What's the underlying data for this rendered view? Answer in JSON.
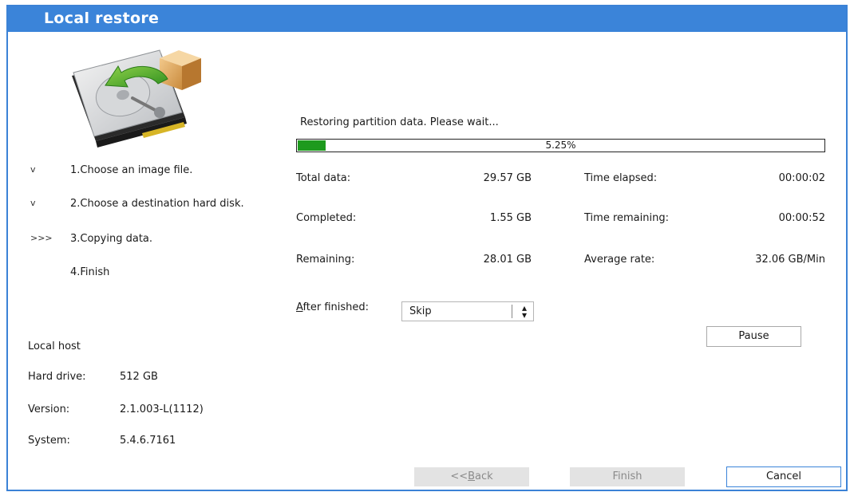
{
  "window": {
    "title": "Local restore"
  },
  "steps": [
    {
      "marker": "v",
      "label": "1.Choose an image file."
    },
    {
      "marker": "v",
      "label": "2.Choose a destination hard disk."
    },
    {
      "marker": ">>>",
      "label": "3.Copying data."
    },
    {
      "marker": "",
      "label": "4.Finish"
    }
  ],
  "host": {
    "heading": "Local host",
    "hard_drive_label": "Hard drive:",
    "hard_drive_value": "512 GB",
    "version_label": "Version:",
    "version_value": "2.1.003-L(1112)",
    "system_label": "System:",
    "system_value": "5.4.6.7161"
  },
  "progress": {
    "status_text": "Restoring partition data. Please wait...",
    "percent_label": "5.25%",
    "fraction": 0.0525,
    "fill_color": "#1d9a1d"
  },
  "stats": {
    "total_label": "Total data:",
    "total_value": "29.57 GB",
    "completed_label": "Completed:",
    "completed_value": "1.55 GB",
    "remaining_label": "Remaining:",
    "remaining_value": "28.01 GB",
    "elapsed_label": "Time elapsed:",
    "elapsed_value": "00:00:02",
    "time_remaining_label": "Time remaining:",
    "time_remaining_value": "00:00:52",
    "rate_label": "Average rate:",
    "rate_value": "32.06 GB/Min"
  },
  "after_finished": {
    "label_prefix": "A",
    "label_rest": "fter finished:",
    "selected": "Skip"
  },
  "buttons": {
    "pause": "Pause",
    "back_prefix": "<<",
    "back_accel": "B",
    "back_rest": "ack",
    "finish": "Finish",
    "cancel": "Cancel"
  },
  "colors": {
    "titlebar": "#3b84d9",
    "accent": "#3b84d9"
  },
  "icons": {
    "hero": "hard-disk-restore-icon",
    "select_arrows": "updown-arrows-icon"
  }
}
